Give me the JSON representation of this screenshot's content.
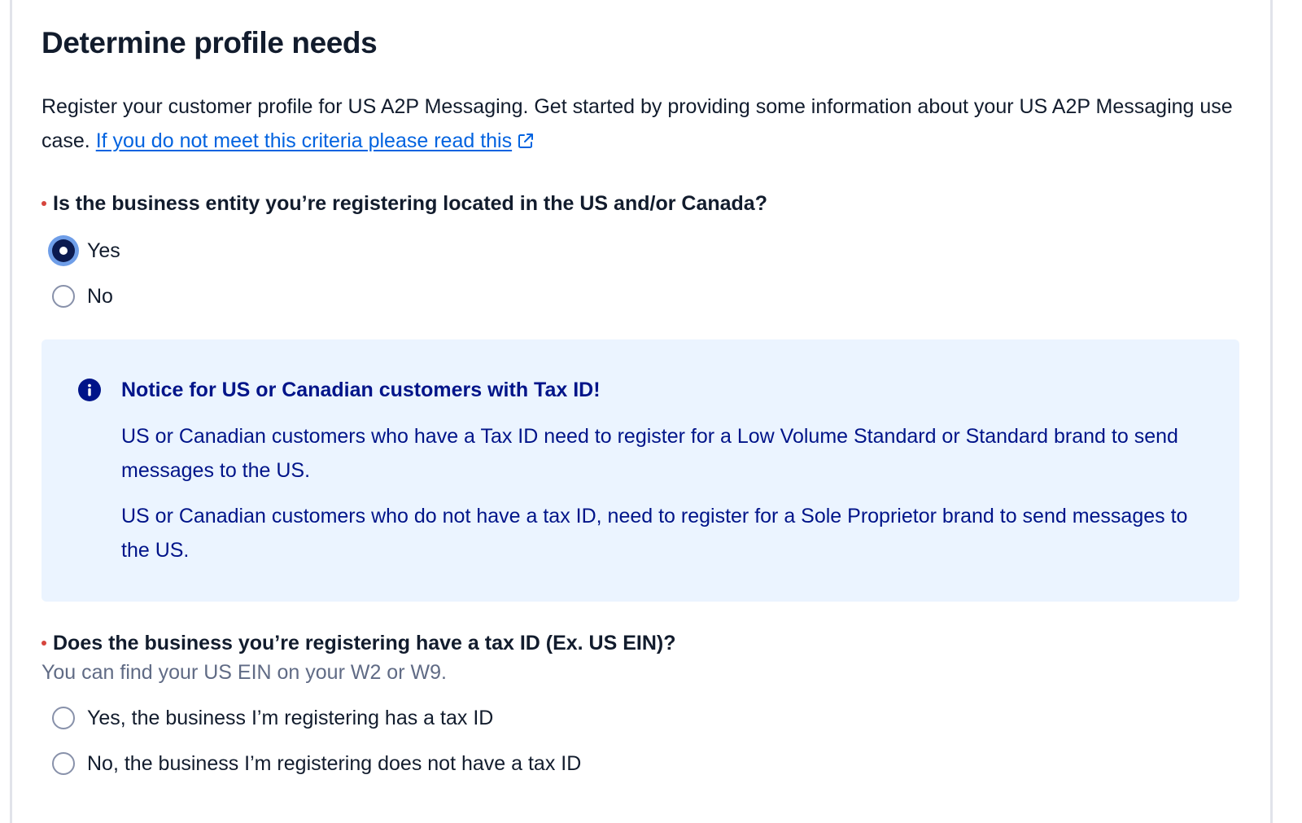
{
  "page": {
    "title": "Determine profile needs",
    "intro_text": "Register your customer profile for US A2P Messaging. Get started by providing some information about your US A2P Messaging use case.",
    "intro_link": "If you do not meet this criteria please read this"
  },
  "question_location": {
    "label": "Is the business entity you’re registering located in the US and/or Canada?",
    "options": [
      {
        "label": "Yes",
        "selected": true
      },
      {
        "label": "No",
        "selected": false
      }
    ]
  },
  "notice": {
    "title": "Notice for US or Canadian customers with Tax ID!",
    "paragraphs": [
      "US or Canadian customers who have a Tax ID need to register for a Low Volume Standard or Standard brand to send messages to the US.",
      "US or Canadian customers who do not have a tax ID, need to register for a Sole Proprietor brand to send messages to the US."
    ],
    "icon": "info-icon"
  },
  "question_tax_id": {
    "label": "Does the business you’re registering have a tax ID (Ex. US EIN)?",
    "help_text": "You can find your US EIN on your W2 or W9.",
    "options": [
      {
        "label": "Yes, the business I’m registering has a tax ID",
        "selected": false
      },
      {
        "label": "No, the business I’m registering does not have a tax ID",
        "selected": false
      }
    ]
  },
  "colors": {
    "link": "#0263e0",
    "notice_background": "#ebf4ff",
    "notice_text": "#001489",
    "required_marker": "#d6453d",
    "radio_checked": "#0b1a4f"
  }
}
